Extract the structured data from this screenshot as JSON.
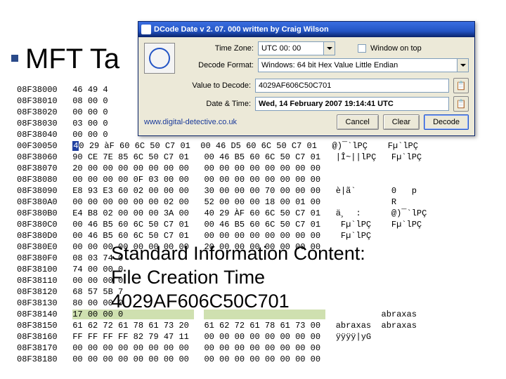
{
  "slide": {
    "title": "MFT Ta"
  },
  "annotation": {
    "line1": "Standard Information Content:",
    "line2": "File Creation Time",
    "line3": "4029AF606C50C701"
  },
  "dcode": {
    "title": "DCode Date  v 2. 07. 000   written by Craig Wilson",
    "labels": {
      "timezone": "Time Zone:",
      "format": "Decode Format:",
      "value": "Value to Decode:",
      "datetime": "Date & Time:",
      "ontop": "Window on top"
    },
    "timezone_value": "UTC  00: 00",
    "format_value": "Windows: 64 bit Hex Value   Little Endian",
    "value_to_decode": "4029AF606C50C701",
    "datetime_value": "Wed, 14 February 2007 19:14:41  UTC",
    "url": "www.digital-detective.co.uk",
    "buttons": {
      "cancel": "Cancel",
      "clear": "Clear",
      "decode": "Decode"
    }
  },
  "hex": {
    "rows": [
      {
        "o": "08F38000",
        "h1": "46 49 4",
        "h2": "",
        "a": ""
      },
      {
        "o": "08F38010",
        "h1": "08 00 0",
        "h2": "",
        "a": ""
      },
      {
        "o": "08F38020",
        "h1": "00 00 0",
        "h2": "",
        "a": ""
      },
      {
        "o": "08F38030",
        "h1": "03 00 0",
        "h2": "",
        "a": ""
      },
      {
        "o": "08F38040",
        "h1": "00 00 0",
        "h2": "",
        "a": ""
      },
      {
        "o": "00F30050",
        "h1": "40 29 àF 60 6C 50 C7 01",
        "h2": "00 46 D5 60 6C 50 C7 01",
        "a": "@)¯`lPÇ    Fµ`lPÇ"
      },
      {
        "o": "08F38060",
        "h1": "90 CE 7E 85 6C 50 C7 01",
        "h2": "00 46 B5 60 6C 50 C7 01",
        "a": "|Î~||lPÇ   Fµ`lPÇ"
      },
      {
        "o": "08F38070",
        "h1": "20 00 00 00 00 00 00 00",
        "h2": "00 00 00 00 00 00 00 00",
        "a": ""
      },
      {
        "o": "08F38080",
        "h1": "00 00 00 00 0F 03 00 00",
        "h2": "00 00 00 00 00 00 00 00",
        "a": ""
      },
      {
        "o": "08F38090",
        "h1": "E8 93 E3 60 02 00 00 00",
        "h2": "30 00 00 00 70 00 00 00",
        "a": "è|ã`       0   p"
      },
      {
        "o": "08F380A0",
        "h1": "00 00 00 00 00 00 02 00",
        "h2": "52 00 00 00 18 00 01 00",
        "a": "           R"
      },
      {
        "o": "08F380B0",
        "h1": "E4 B8 02 00 00 00 3A 00",
        "h2": "40 29 ÀF 60 6C 50 C7 01",
        "a": "ä¸  :      @)¯`lPÇ"
      },
      {
        "o": "08F380C0",
        "h1": "00 46 B5 60 6C 50 C7 01",
        "h2": "00 46 B5 60 6C 50 C7 01",
        "a": " Fµ`lPÇ    Fµ`lPÇ"
      },
      {
        "o": "08F380D0",
        "h1": "00 46 B5 60 6C 50 C7 01",
        "h2": "00 00 00 00 00 00 00 00",
        "a": " Fµ`lPÇ"
      },
      {
        "o": "08F380E0",
        "h1": "00 00 00 00 00 00 00 00",
        "h2": "20 00 00 00 00 00 00 00",
        "a": ""
      },
      {
        "o": "08F380F0",
        "h1": "08 03 74 0",
        "h2": "",
        "a": ""
      },
      {
        "o": "08F38100",
        "h1": "74 00 00 0",
        "h2": "",
        "a": ""
      },
      {
        "o": "08F38110",
        "h1": "00 00 00 0",
        "h2": "",
        "a": ""
      },
      {
        "o": "08F38120",
        "h1": "68 57 5B 7",
        "h2": "",
        "a": ""
      },
      {
        "o": "08F38130",
        "h1": "80 00 00 0",
        "h2": "",
        "a": ""
      },
      {
        "o": "08F38140",
        "h1": "17 00 00 0",
        "h2": "",
        "a": "         abraxas"
      },
      {
        "o": "08F38150",
        "h1": "61 62 72 61 78 61 73 20",
        "h2": "61 62 72 61 78 61 73 00",
        "a": "abraxas  abraxas"
      },
      {
        "o": "08F38160",
        "h1": "FF FF FF FF 82 79 47 11",
        "h2": "00 00 00 00 00 00 00 00",
        "a": "ÿÿÿÿ|yG"
      },
      {
        "o": "08F38170",
        "h1": "00 00 00 00 00 00 00 00",
        "h2": "00 00 00 00 00 00 00 00",
        "a": ""
      },
      {
        "o": "08F38180",
        "h1": "00 00 00 00 00 00 00 00",
        "h2": "00 00 00 00 00 00 00 00",
        "a": ""
      }
    ]
  }
}
